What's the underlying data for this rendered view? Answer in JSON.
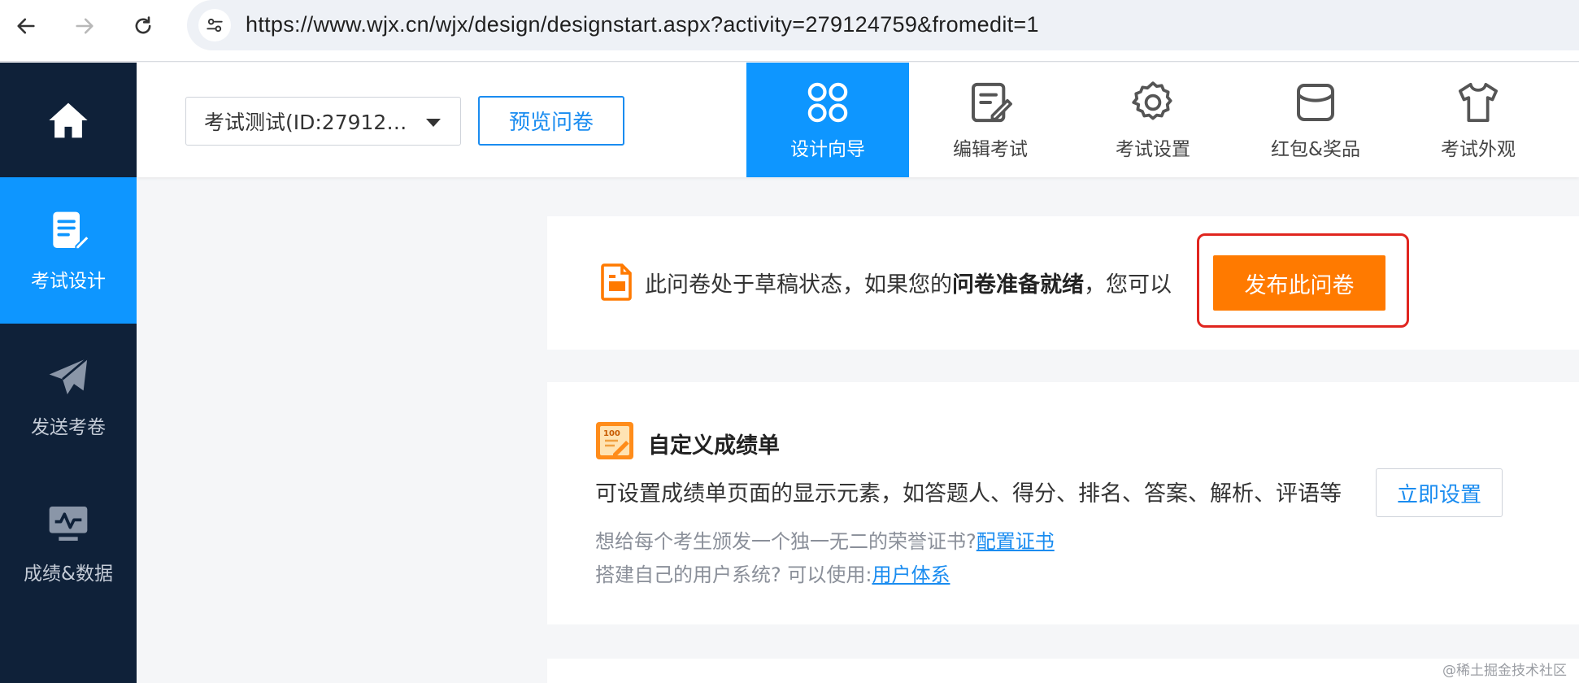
{
  "browser": {
    "url": "https://www.wjx.cn/wjx/design/designstart.aspx?activity=279124759&fromedit=1"
  },
  "sidebar": {
    "items": [
      {
        "label": "考试设计",
        "icon": "edit-document-icon"
      },
      {
        "label": "发送考卷",
        "icon": "paper-plane-icon"
      },
      {
        "label": "成绩&数据",
        "icon": "monitor-chart-icon"
      }
    ]
  },
  "toolbar": {
    "exam_select_value": "考试测试(ID:27912…",
    "preview_label": "预览问卷",
    "tabs": [
      {
        "label": "设计向导",
        "icon": "grid-icon"
      },
      {
        "label": "编辑考试",
        "icon": "edit-icon"
      },
      {
        "label": "考试设置",
        "icon": "gear-icon"
      },
      {
        "label": "红包&奖品",
        "icon": "gift-box-icon"
      },
      {
        "label": "考试外观",
        "icon": "tshirt-icon"
      }
    ]
  },
  "status": {
    "text_prefix": "此问卷处于草稿状态，如果您的",
    "text_bold": "问卷准备就绪",
    "text_suffix": "，您可以",
    "publish_label": "发布此问卷"
  },
  "score_card": {
    "title": "自定义成绩单",
    "description": "可设置成绩单页面的显示元素，如答题人、得分、排名、答案、解析、评语等",
    "setup_label": "立即设置",
    "hint1_text": "想给每个考生颁发一个独一无二的荣誉证书?",
    "hint1_link": "配置证书",
    "hint2_text": "搭建自己的用户系统? 可以使用:",
    "hint2_link": "用户体系"
  },
  "watermark": "@稀土掘金技术社区",
  "colors": {
    "sidebar_bg": "#0f2139",
    "accent_blue": "#0e96ff",
    "publish_orange": "#ff7a00",
    "highlight_red": "#e0251f"
  }
}
